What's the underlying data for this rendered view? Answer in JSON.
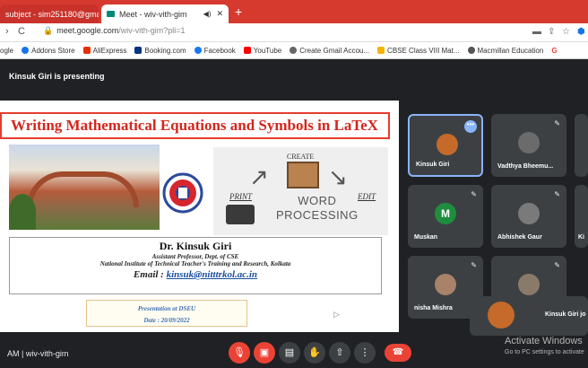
{
  "browser": {
    "tabs": [
      {
        "label": "subject - sim251180@gma",
        "close": "✕"
      },
      {
        "label": "Meet - wiv-vith-gim",
        "close": "✕",
        "sound": "◀)"
      }
    ],
    "new_tab": "+",
    "url_host": "meet.google.com",
    "url_path": "/wiv-vith-gim?pli=1",
    "bookmarks": [
      {
        "label": "ogle",
        "color": "#4285f4"
      },
      {
        "label": "Addons Store",
        "color": "#1a73e8"
      },
      {
        "label": "AliExpress",
        "color": "#e62e04"
      },
      {
        "label": "Booking.com",
        "color": "#003580"
      },
      {
        "label": "Facebook",
        "color": "#1877f2"
      },
      {
        "label": "YouTube",
        "color": "#ff0000"
      },
      {
        "label": "Create Gmail Accou...",
        "color": "#666666"
      },
      {
        "label": "CBSE Class VIII Mat...",
        "color": "#f4b400"
      },
      {
        "label": "Macmillan Education",
        "color": "#555555"
      },
      {
        "label": "G",
        "color": "#ffffff"
      }
    ]
  },
  "meet": {
    "presenting_label": "Kinsuk Giri is presenting",
    "slide": {
      "title": "Writing Mathematical Equations and Symbols in LaTeX",
      "create": "CREATE",
      "print": "PRINT",
      "word_processing_1": "WORD",
      "word_processing_2": "PROCESSING",
      "edit": "EDIT",
      "author_name": "Dr. Kinsuk  Giri",
      "author_role": "Assistant Professor, Dept. of CSE",
      "author_inst": "National Institute of Technical Teacher's Training and Research, Kolkata",
      "email_label": "Email : ",
      "email": "kinsuk@nitttrkol.ac.in",
      "presented_at": "Presentation  at  DSEU",
      "date": "Date : 20/09/2022"
    },
    "participants": [
      {
        "name": "Kinsuk Giri",
        "avatar_color": "#c56a2a"
      },
      {
        "name": "Vadthya Bheemu...",
        "avatar_color": "#6b6b6b"
      },
      {
        "name": "Muskan",
        "avatar_letter": "M",
        "avatar_color": "#1e8e3e"
      },
      {
        "name": "Abhishek Gaur",
        "avatar_color": "#7a7a7a"
      },
      {
        "name": "nisha Mishra",
        "avatar_color": "#a9826a"
      },
      {
        "name": "",
        "avatar_color": "#8a7a6a"
      }
    ],
    "self_name": "Kinsuk Giri jo",
    "time_meeting": "AM  |  wiv-vith-gim",
    "activate_title": "Activate Windows",
    "activate_sub": "Go to PC settings to activate"
  }
}
